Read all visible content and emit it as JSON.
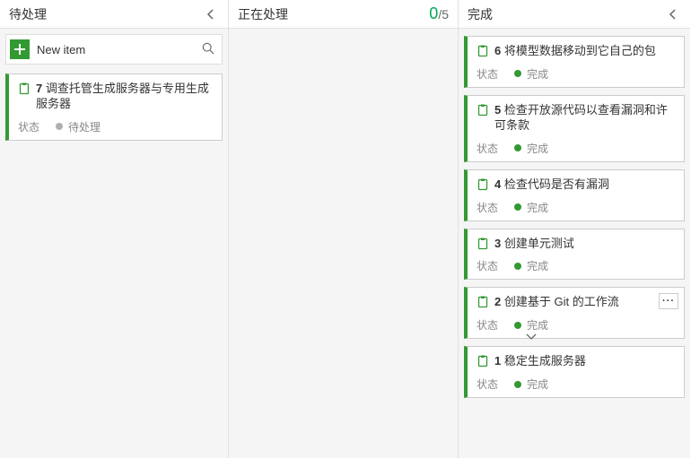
{
  "columns": {
    "pending": {
      "title": "待处理",
      "newItemLabel": "New item",
      "statusLabel": "状态",
      "cards": [
        {
          "num": "7",
          "title": "调查托管生成服务器与专用生成服务器",
          "status": "待处理",
          "dot": "grey"
        }
      ]
    },
    "processing": {
      "title": "正在处理",
      "countNum": "0",
      "countDen": "/5"
    },
    "done": {
      "title": "完成",
      "statusLabel": "状态",
      "cards": [
        {
          "num": "6",
          "title": "将模型数据移动到它自己的包",
          "status": "完成",
          "dot": "green"
        },
        {
          "num": "5",
          "title": "检查开放源代码以查看漏洞和许可条款",
          "status": "完成",
          "dot": "green"
        },
        {
          "num": "4",
          "title": "检查代码是否有漏洞",
          "status": "完成",
          "dot": "green"
        },
        {
          "num": "3",
          "title": "创建单元测试",
          "status": "完成",
          "dot": "green"
        },
        {
          "num": "2",
          "title": "创建基于 Git 的工作流",
          "status": "完成",
          "dot": "green",
          "showMore": true,
          "showChevron": true
        },
        {
          "num": "1",
          "title": "稳定生成服务器",
          "status": "完成",
          "dot": "green"
        }
      ]
    }
  }
}
